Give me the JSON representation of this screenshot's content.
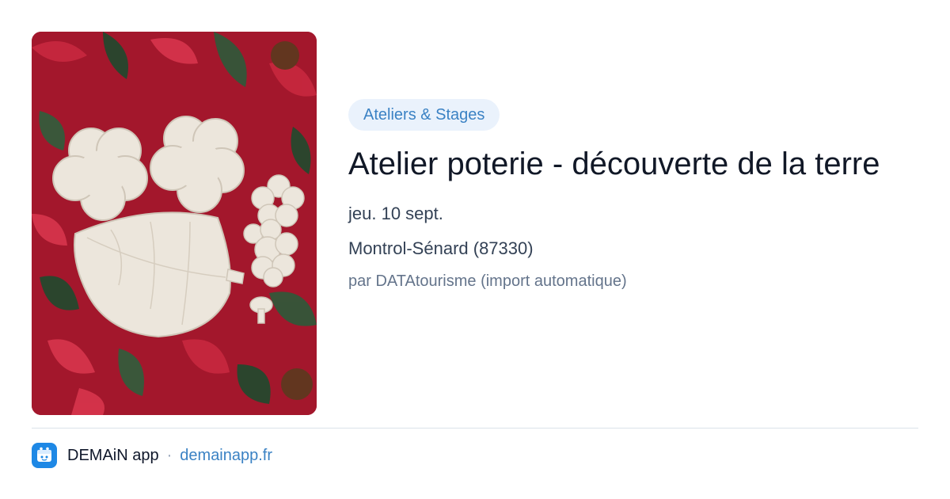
{
  "event": {
    "category": "Ateliers & Stages",
    "title": "Atelier poterie - découverte de la terre",
    "date": "jeu. 10 sept.",
    "location": "Montrol-Sénard (87330)",
    "source": "par DATAtourisme (import automatique)"
  },
  "image": {
    "icon": "pottery-photo"
  },
  "footer": {
    "app_name": "DEMAiN app",
    "separator": "·",
    "domain": "demainapp.fr",
    "logo_icon": "demain-app-logo-icon"
  },
  "colors": {
    "tag_background": "#eaf2fc",
    "tag_text": "#3b82c4",
    "link": "#3b82c4",
    "logo": "#1e88e5"
  }
}
